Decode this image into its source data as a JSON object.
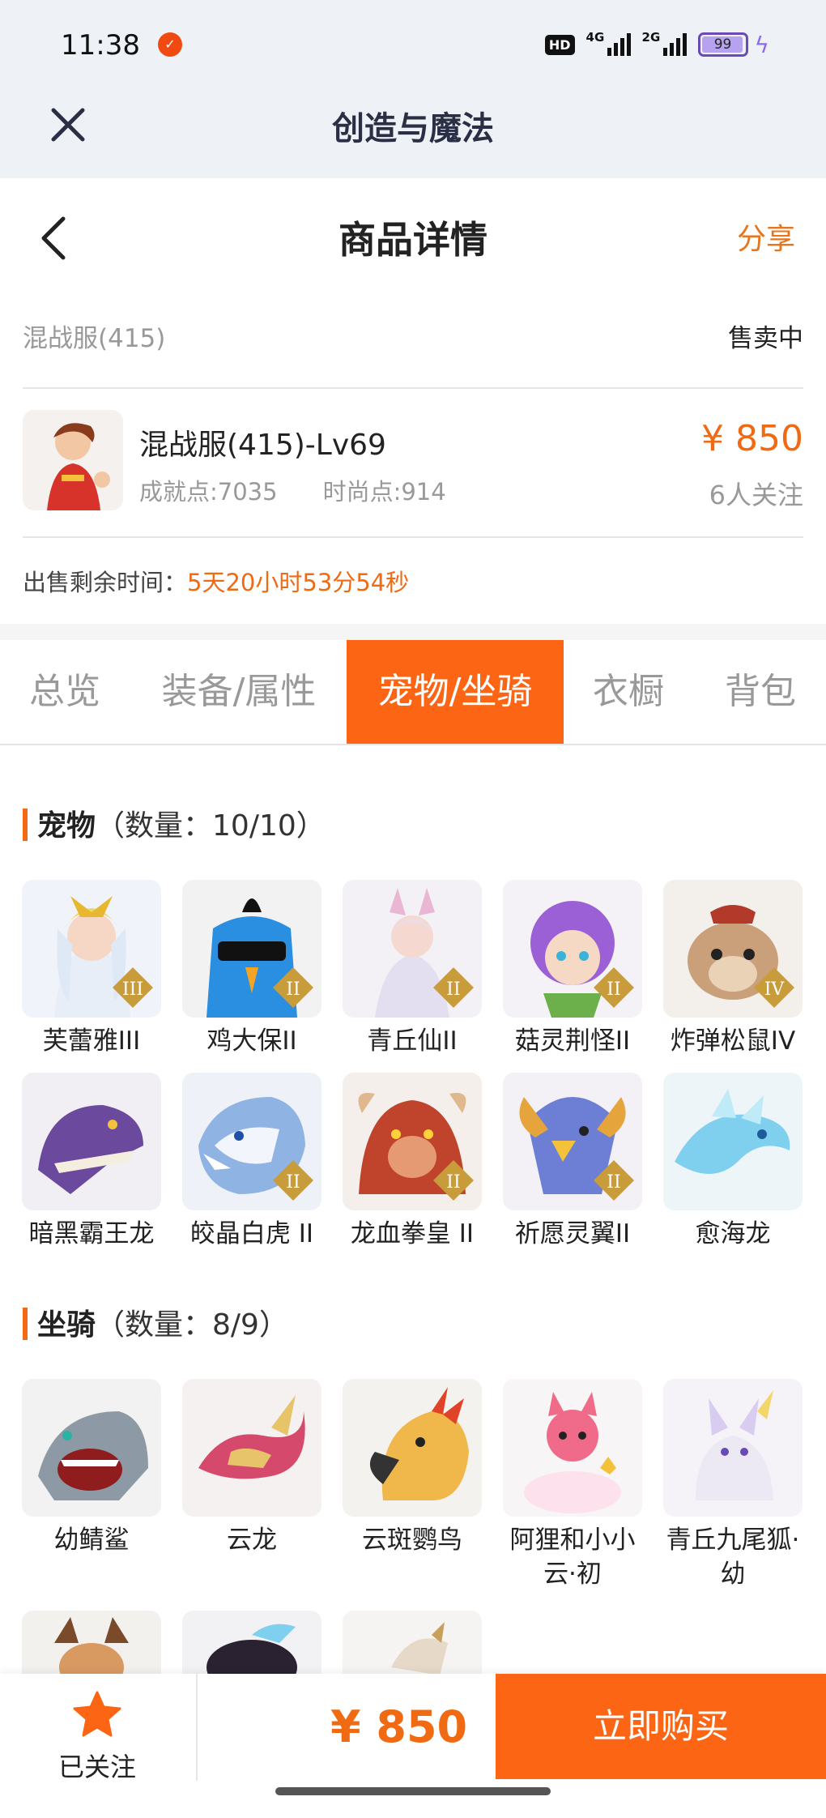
{
  "status_bar": {
    "time": "11:38",
    "network_1": "4G",
    "network_2": "2G",
    "hd_label": "HD",
    "battery": "99"
  },
  "app_bar": {
    "title": "创造与魔法"
  },
  "header": {
    "title": "商品详情",
    "share": "分享"
  },
  "listing": {
    "server": "混战服(415)",
    "status": "售卖中",
    "character_name": "混战服(415)-Lv69",
    "achievement": "成就点:7035",
    "fashion": "时尚点:914",
    "price": "¥ 850",
    "followers": "6人关注",
    "remaining_label": "出售剩余时间：",
    "remaining_value": "5天20小时53分54秒"
  },
  "tabs": [
    "总览",
    "装备/属性",
    "宠物/坐骑",
    "衣橱",
    "背包"
  ],
  "active_tab": "宠物/坐骑",
  "pets": {
    "title": "宠物",
    "count": "（数量：10/10）",
    "items": [
      {
        "name": "芙蕾雅III",
        "badge": "III"
      },
      {
        "name": "鸡大保II",
        "badge": "II"
      },
      {
        "name": "青丘仙II",
        "badge": "II"
      },
      {
        "name": "菇灵荆怪II",
        "badge": "II"
      },
      {
        "name": "炸弹松鼠IV",
        "badge": "IV"
      },
      {
        "name": "暗黑霸王龙",
        "badge": ""
      },
      {
        "name": "皎晶白虎 II",
        "badge": "II"
      },
      {
        "name": "龙血拳皇 II",
        "badge": "II"
      },
      {
        "name": "祈愿灵翼II",
        "badge": "II"
      },
      {
        "name": "愈海龙",
        "badge": ""
      }
    ]
  },
  "mounts": {
    "title": "坐骑",
    "count": "（数量：8/9）",
    "items": [
      {
        "name": "幼鲭鲨"
      },
      {
        "name": "云龙"
      },
      {
        "name": "云斑鹦鸟"
      },
      {
        "name": "阿狸和小小云·初"
      },
      {
        "name": "青丘九尾狐·幼"
      }
    ]
  },
  "bottom": {
    "follow_label": "已关注",
    "price": "¥ 850",
    "buy_label": "立即购买"
  },
  "colors": {
    "accent": "#fc6514",
    "price": "#ef6a12"
  }
}
